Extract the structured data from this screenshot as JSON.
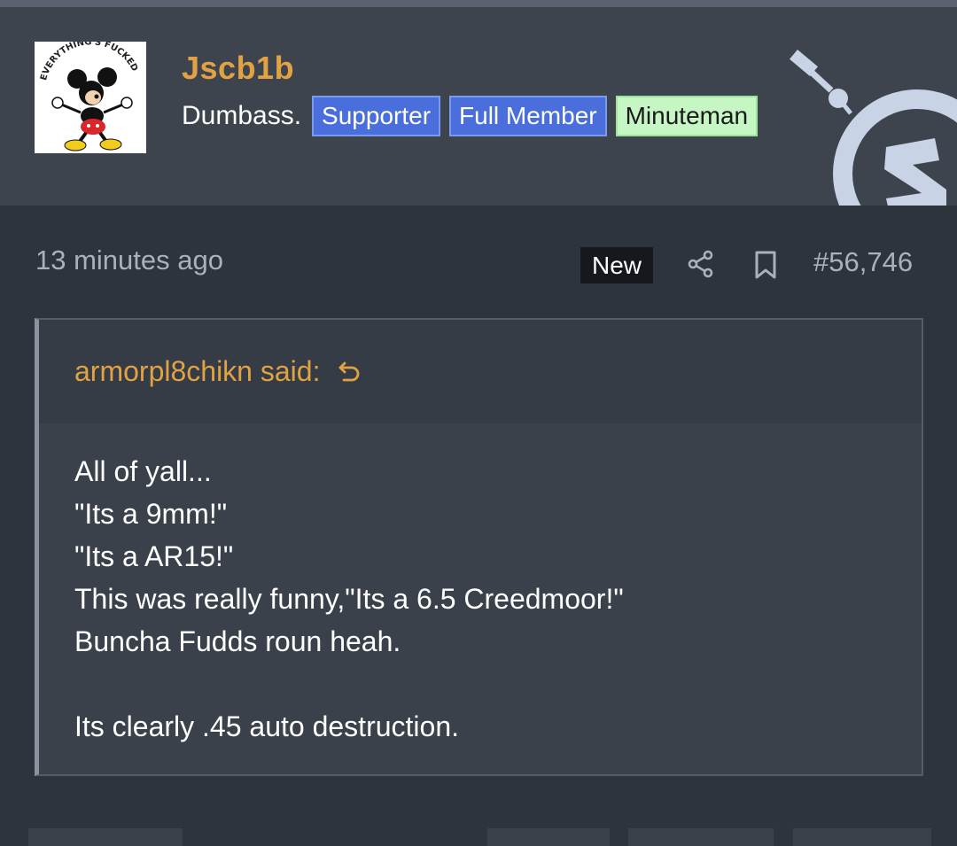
{
  "post": {
    "username": "Jscb1b",
    "user_title": "Dumbass.",
    "badges": [
      {
        "label": "Supporter",
        "style": "blue"
      },
      {
        "label": "Full Member",
        "style": "blue"
      },
      {
        "label": "Minuteman",
        "style": "green"
      }
    ],
    "avatar_caption": "EVERYTHING'S FUCKED",
    "timestamp": "13 minutes ago",
    "new_label": "New",
    "post_number": "#56,746"
  },
  "quote": {
    "author_label": "armorpl8chikn said:",
    "lines": [
      "All of yall...",
      "\"Its a 9mm!\"",
      "\"Its a AR15!\"",
      "This was really funny,\"Its a 6.5 Creedmoor!\"",
      "Buncha Fudds roun heah.",
      "",
      "Its clearly .45 auto destruction."
    ]
  },
  "colors": {
    "accent": "#e0a243",
    "badge_blue": "#4a6fdc",
    "badge_green": "#c6f6c4",
    "header_bg": "#3d444e",
    "page_bg": "#2e343c"
  },
  "icons": {
    "share": "share-icon",
    "bookmark": "bookmark-icon",
    "quote_jump": "jump-to-quote-icon",
    "site_logo": "site-logo-icon"
  }
}
